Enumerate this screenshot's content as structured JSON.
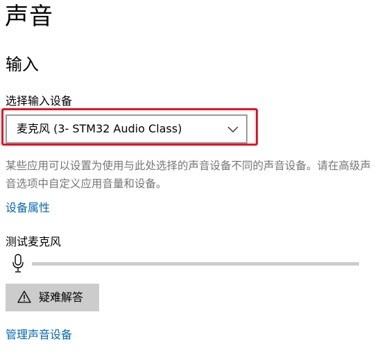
{
  "page": {
    "title": "声音"
  },
  "input_section": {
    "title": "输入",
    "select_label": "选择输入设备",
    "selected_device": "麦克风 (3- STM32 Audio Class)",
    "description": "某些应用可以设置为使用与此处选择的声音设备不同的声音设备。请在高级声音选项中自定义应用音量和设备。",
    "device_properties_link": "设备属性",
    "test_label": "测试麦克风",
    "mic_level_percent": 0,
    "troubleshoot_label": "疑难解答",
    "manage_devices_link": "管理声音设备"
  },
  "icons": {
    "dropdown": "chevron-down-icon",
    "microphone": "microphone-icon",
    "warning": "warning-icon"
  },
  "colors": {
    "link": "#0067b8",
    "highlight": "#e81123",
    "level_track": "#cccccc",
    "level_fill": "#0078d7",
    "description_text": "#767676"
  }
}
